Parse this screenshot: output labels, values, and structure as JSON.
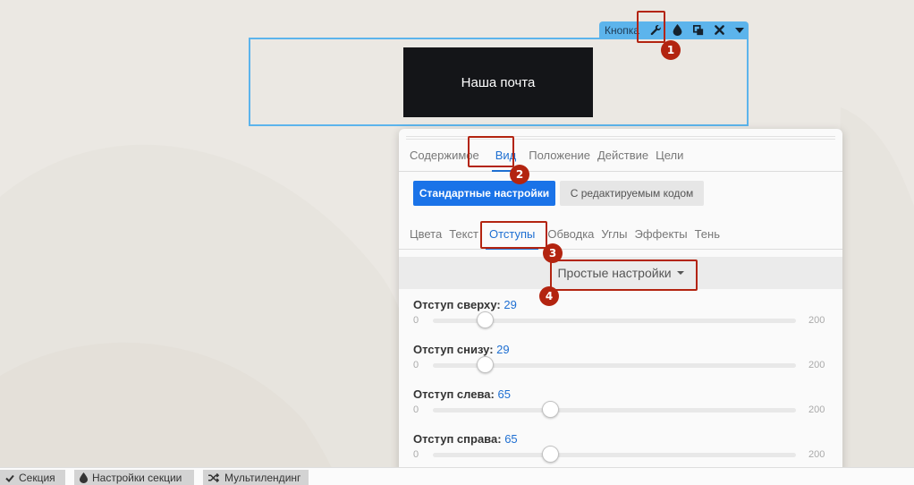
{
  "canvas": {
    "button_text": "Наша почта"
  },
  "element_toolbar": {
    "label": "Кнопка",
    "icons": [
      "wrench-icon",
      "drop-icon",
      "copy-icon",
      "close-icon",
      "caret-down-icon"
    ]
  },
  "markers": [
    "1",
    "2",
    "3",
    "4"
  ],
  "panel": {
    "main_tabs": [
      "Содержимое",
      "Вид",
      "Положение",
      "Действие",
      "Цели"
    ],
    "active_main_tab": "Вид",
    "mode_buttons": {
      "standard": "Стандартные настройки",
      "code": "С редактируемым кодом"
    },
    "sub_tabs": [
      "Цвета",
      "Текст",
      "Отступы",
      "Обводка",
      "Углы",
      "Эффекты",
      "Тень"
    ],
    "active_sub_tab": "Отступы",
    "dropdown_label": "Простые настройки",
    "sliders": [
      {
        "label": "Отступ сверху:",
        "value": "29",
        "min": "0",
        "max": "200"
      },
      {
        "label": "Отступ снизу:",
        "value": "29",
        "min": "0",
        "max": "200"
      },
      {
        "label": "Отступ слева:",
        "value": "65",
        "min": "0",
        "max": "200"
      },
      {
        "label": "Отступ справа:",
        "value": "65",
        "min": "0",
        "max": "200"
      }
    ]
  },
  "bottom_bar": {
    "section": "Секция",
    "section_settings": "Настройки секции",
    "multilanding": "Мультилендинг"
  },
  "colors": {
    "accent": "#1a73e8",
    "highlight": "#b32410",
    "toolbar": "#5cb4ec"
  }
}
